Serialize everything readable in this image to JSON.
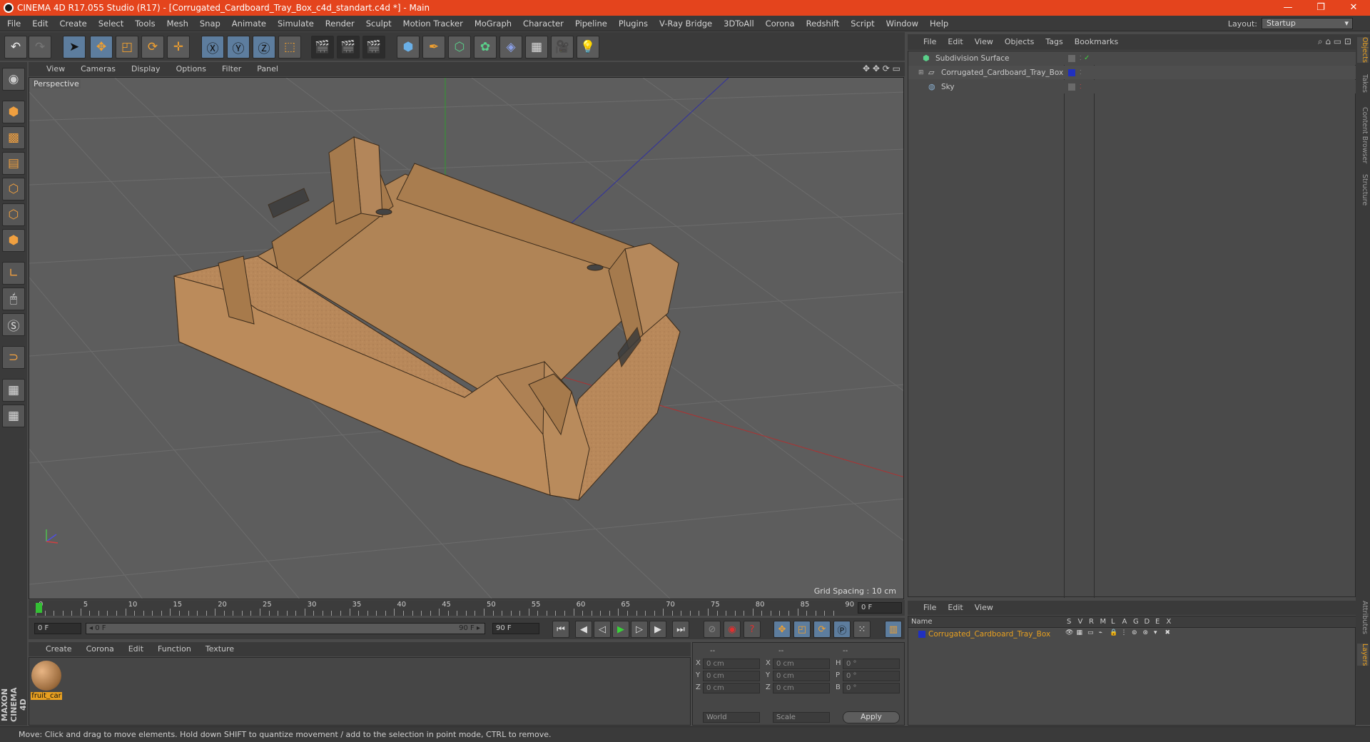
{
  "app": {
    "title": "CINEMA 4D R17.055 Studio (R17) - [Corrugated_Cardboard_Tray_Box_c4d_standart.c4d *] - Main",
    "minimize_icon": "minimize-icon",
    "maximize_icon": "restore-icon",
    "close_icon": "close-icon"
  },
  "menu": [
    "File",
    "Edit",
    "Create",
    "Select",
    "Tools",
    "Mesh",
    "Snap",
    "Animate",
    "Simulate",
    "Render",
    "Sculpt",
    "Motion Tracker",
    "MoGraph",
    "Character",
    "Pipeline",
    "Plugins",
    "V-Ray Bridge",
    "3DToAll",
    "Corona",
    "Redshift",
    "Script",
    "Window",
    "Help"
  ],
  "layout": {
    "label": "Layout:",
    "value": "Startup"
  },
  "viewport": {
    "menu": [
      "View",
      "Cameras",
      "Display",
      "Options",
      "Filter",
      "Panel"
    ],
    "label": "Perspective",
    "grid_spacing": "Grid Spacing : 10 cm"
  },
  "timeline": {
    "ticks": [
      "0",
      "5",
      "10",
      "15",
      "20",
      "25",
      "30",
      "35",
      "40",
      "45",
      "50",
      "55",
      "60",
      "65",
      "70",
      "75",
      "80",
      "85",
      "90"
    ],
    "current_frame": "0 F",
    "start_field": "0 F",
    "range_start": "◂ 0 F",
    "range_end": "90 F ▸",
    "end_field": "90 F"
  },
  "material": {
    "menu": [
      "Create",
      "Corona",
      "Edit",
      "Function",
      "Texture"
    ],
    "items": [
      {
        "name": "fruit_car"
      }
    ]
  },
  "coords": {
    "headers": [
      "--",
      "--",
      "--"
    ],
    "rows": [
      {
        "a": "X",
        "av": "0 cm",
        "b": "X",
        "bv": "0 cm",
        "c": "H",
        "cv": "0 °"
      },
      {
        "a": "Y",
        "av": "0 cm",
        "b": "Y",
        "bv": "0 cm",
        "c": "P",
        "cv": "0 °"
      },
      {
        "a": "Z",
        "av": "0 cm",
        "b": "Z",
        "bv": "0 cm",
        "c": "B",
        "cv": "0 °"
      }
    ],
    "mode1": "World",
    "mode2": "Scale",
    "apply": "Apply"
  },
  "objects": {
    "menu": [
      "File",
      "Edit",
      "View",
      "Objects",
      "Tags",
      "Bookmarks"
    ],
    "items": [
      {
        "name": "Subdivision Surface",
        "color": "#c8c8c8"
      },
      {
        "name": "Corrugated_Cardboard_Tray_Box",
        "color": "#c8c8c8"
      },
      {
        "name": "Sky",
        "color": "#c8c8c8"
      }
    ]
  },
  "layers": {
    "menu": [
      "File",
      "Edit",
      "View"
    ],
    "columns": [
      "Name",
      "S",
      "V",
      "R",
      "M",
      "L",
      "A",
      "G",
      "D",
      "E",
      "X"
    ],
    "items": [
      {
        "name": "Corrugated_Cardboard_Tray_Box",
        "color": "#e8a020"
      }
    ]
  },
  "side_tabs": [
    "Objects",
    "Takes",
    "Content Browser",
    "Structure",
    "Attributes",
    "Layers"
  ],
  "brand": "MAXON CINEMA 4D",
  "status": "Move: Click and drag to move elements. Hold down SHIFT to quantize movement / add to the selection in point mode, CTRL to remove.",
  "colors": {
    "titlebar": "#e4441d",
    "accent": "#e8a020",
    "box": "#b8885a"
  }
}
